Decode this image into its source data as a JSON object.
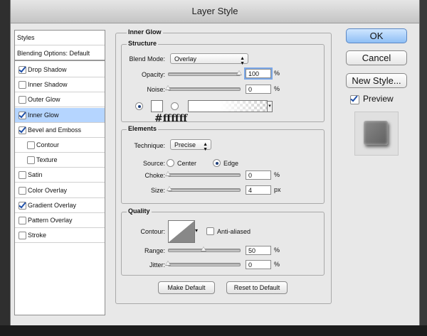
{
  "window": {
    "title": "Layer Style"
  },
  "styles_panel": {
    "header": "Styles",
    "blending": "Blending Options: Default",
    "items": [
      {
        "label": "Drop Shadow",
        "checked": true,
        "selected": false,
        "indent": false
      },
      {
        "label": "Inner Shadow",
        "checked": false,
        "selected": false,
        "indent": false
      },
      {
        "label": "Outer Glow",
        "checked": false,
        "selected": false,
        "indent": false
      },
      {
        "label": "Inner Glow",
        "checked": true,
        "selected": true,
        "indent": false
      },
      {
        "label": "Bevel and Emboss",
        "checked": true,
        "selected": false,
        "indent": false
      },
      {
        "label": "Contour",
        "checked": false,
        "selected": false,
        "indent": true
      },
      {
        "label": "Texture",
        "checked": false,
        "selected": false,
        "indent": true
      },
      {
        "label": "Satin",
        "checked": false,
        "selected": false,
        "indent": false
      },
      {
        "label": "Color Overlay",
        "checked": false,
        "selected": false,
        "indent": false
      },
      {
        "label": "Gradient Overlay",
        "checked": true,
        "selected": false,
        "indent": false
      },
      {
        "label": "Pattern Overlay",
        "checked": false,
        "selected": false,
        "indent": false
      },
      {
        "label": "Stroke",
        "checked": false,
        "selected": false,
        "indent": false
      }
    ]
  },
  "inner_glow": {
    "title": "Inner Glow",
    "structure": {
      "title": "Structure",
      "blend_mode_label": "Blend Mode:",
      "blend_mode_value": "Overlay",
      "opacity_label": "Opacity:",
      "opacity_value": "100",
      "opacity_unit": "%",
      "opacity_fraction": 1.0,
      "noise_label": "Noise:",
      "noise_value": "0",
      "noise_unit": "%",
      "noise_fraction": 0.0,
      "color_annotation": "#ffffff",
      "color_swatch": "#ffffff"
    },
    "elements": {
      "title": "Elements",
      "technique_label": "Technique:",
      "technique_value": "Precise",
      "source_label": "Source:",
      "source_center": "Center",
      "source_edge": "Edge",
      "choke_label": "Choke:",
      "choke_value": "0",
      "choke_unit": "%",
      "choke_fraction": 0.0,
      "size_label": "Size:",
      "size_value": "4",
      "size_unit": "px",
      "size_fraction": 0.02
    },
    "quality": {
      "title": "Quality",
      "contour_label": "Contour:",
      "anti_aliased_label": "Anti-aliased",
      "range_label": "Range:",
      "range_value": "50",
      "range_unit": "%",
      "range_fraction": 0.5,
      "jitter_label": "Jitter:",
      "jitter_value": "0",
      "jitter_unit": "%",
      "jitter_fraction": 0.0
    },
    "make_default": "Make Default",
    "reset_default": "Reset to Default"
  },
  "actions": {
    "ok": "OK",
    "cancel": "Cancel",
    "new_style": "New Style...",
    "preview": "Preview",
    "preview_checked": true
  }
}
